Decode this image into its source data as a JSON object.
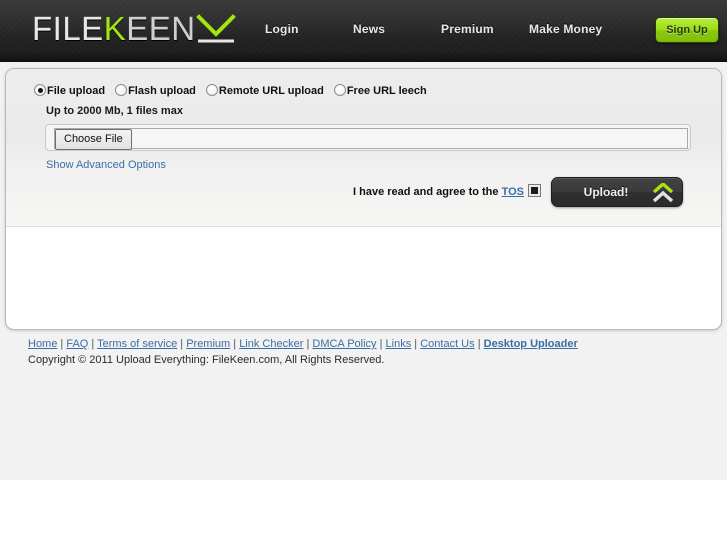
{
  "header": {
    "logo": {
      "part1": "FILE",
      "part2": "K",
      "part3": "EEN",
      "mark_icon": "down-chevron-icon"
    },
    "nav": [
      {
        "label": "Login"
      },
      {
        "label": "News"
      },
      {
        "label": "Premium"
      },
      {
        "label": "Make Money"
      }
    ],
    "signup_label": "Sign Up",
    "accent_green": "#9ddd1b",
    "background": "#2c2c2c"
  },
  "upload": {
    "modes": [
      {
        "label": "File upload",
        "selected": true
      },
      {
        "label": "Flash upload",
        "selected": false
      },
      {
        "label": "Remote URL upload",
        "selected": false
      },
      {
        "label": "Free URL leech",
        "selected": false
      }
    ],
    "limits_text": "Up to 2000 Mb, 1 files max",
    "choose_file_label": "Choose File",
    "file_value": "",
    "advanced_link": "Show Advanced Options",
    "tos_text": "I have read and agree to the ",
    "tos_link": "TOS",
    "tos_checked": true,
    "upload_button_label": "Upload!",
    "upload_button_icon": "double-chevron-up-icon"
  },
  "footer": {
    "links": [
      {
        "label": "Home",
        "bold": false
      },
      {
        "label": "FAQ",
        "bold": false
      },
      {
        "label": "Terms of service",
        "bold": false
      },
      {
        "label": "Premium",
        "bold": false
      },
      {
        "label": "Link Checker",
        "bold": false
      },
      {
        "label": "DMCA Policy",
        "bold": false
      },
      {
        "label": "Links",
        "bold": false
      },
      {
        "label": "Contact Us",
        "bold": false
      },
      {
        "label": "Desktop Uploader",
        "bold": true
      }
    ],
    "separator": " | ",
    "copyright": "Copyright © 2011 Upload Everything: FileKeen.com, All Rights Reserved."
  }
}
